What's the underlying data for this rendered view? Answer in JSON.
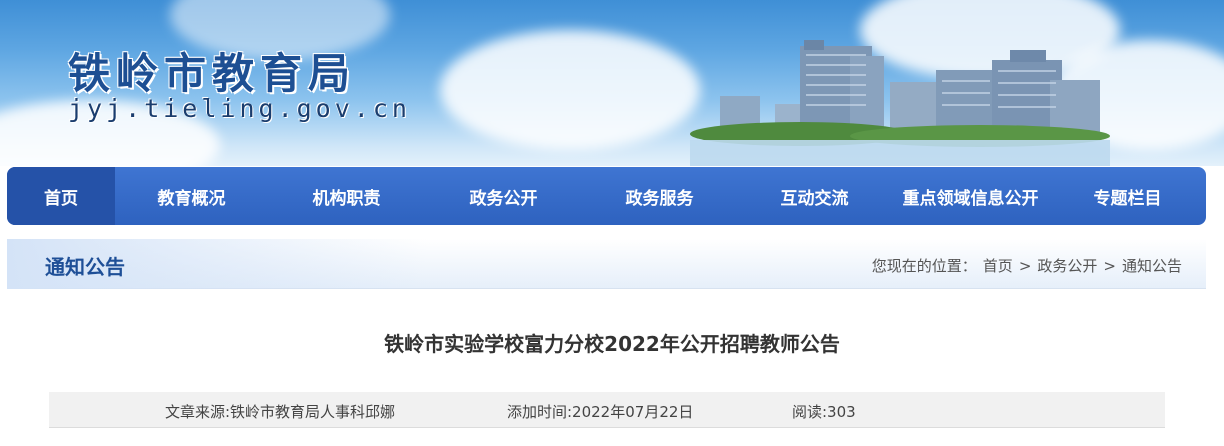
{
  "header": {
    "site_name": "铁岭市教育局",
    "domain": "jyj.tieling.gov.cn"
  },
  "nav": {
    "items": [
      {
        "label": "首页",
        "active": true
      },
      {
        "label": "教育概况"
      },
      {
        "label": "机构职责"
      },
      {
        "label": "政务公开"
      },
      {
        "label": "政务服务"
      },
      {
        "label": "互动交流"
      },
      {
        "label": "重点领域信息公开"
      },
      {
        "label": "专题栏目"
      }
    ]
  },
  "section": {
    "title": "通知公告",
    "location_label": "您现在的位置：",
    "breadcrumb": [
      "首页",
      "政务公开",
      "通知公告"
    ],
    "separator": ">"
  },
  "article": {
    "title": "铁岭市实验学校富力分校2022年公开招聘教师公告",
    "source": "文章来源:铁岭市教育局人事科邱娜",
    "date": "添加时间:2022年07月22日",
    "views": "阅读:303"
  },
  "colors": {
    "nav_bg": "#2e62bf",
    "nav_active": "#2552a8",
    "section_title": "#1e4f97",
    "site_title": "#1d4f93"
  }
}
